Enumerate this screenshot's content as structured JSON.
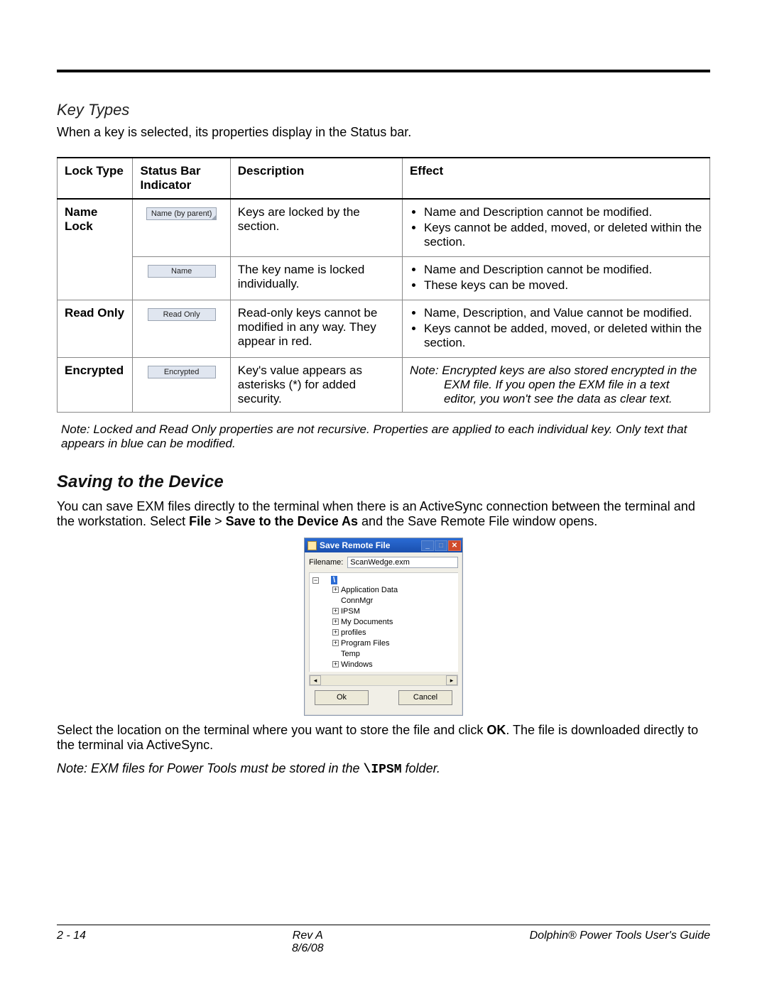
{
  "section": {
    "title": "Key Types",
    "intro": "When a key is selected, its properties display in the Status bar."
  },
  "table": {
    "headers": {
      "locktype": "Lock Type",
      "statusbar": "Status Bar Indicator",
      "description": "Description",
      "effect": "Effect"
    },
    "rows": {
      "namelock": {
        "label": "Name Lock",
        "ind1": "Name (by parent)",
        "desc1": "Keys are locked by the section.",
        "eff1a": "Name and Description cannot be modified.",
        "eff1b": "Keys cannot be added, moved, or deleted within the section.",
        "ind2": "Name",
        "desc2": "The key name is locked individually.",
        "eff2a": "Name and Description cannot be modified.",
        "eff2b": "These keys can be moved."
      },
      "readonly": {
        "label": "Read Only",
        "ind": "Read Only",
        "desc": "Read-only keys cannot be modified in any way. They appear in red.",
        "effa": "Name, Description, and Value cannot be modified.",
        "effb": "Keys cannot be added, moved, or deleted within the section."
      },
      "encrypted": {
        "label": "Encrypted",
        "ind": "Encrypted",
        "desc": "Key's value appears as asterisks (*) for added security.",
        "eff": "Note: Encrypted keys are also stored encrypted in the EXM file. If you open the EXM file in a text editor, you won't see the data as clear text."
      }
    }
  },
  "note1": "Note: Locked and Read Only properties are not recursive. Properties are applied to each individual key. Only text that appears in blue can be modified.",
  "saving": {
    "title": "Saving to the Device",
    "body_pre": "You can save EXM files directly to the terminal when there is an ActiveSync connection between the terminal and the workstation. Select ",
    "menu_file": "File",
    "menu_gt": " > ",
    "menu_save": "Save to the Device As",
    "body_post": " and the Save Remote File window opens.",
    "after": "Select the location on the terminal where you want to store the file and click ",
    "ok_bold": "OK",
    "after2": ". The file is downloaded directly to the terminal via ActiveSync.",
    "note2_pre": "Note: EXM files for Power Tools must be stored in the ",
    "note2_mono": "\\IPSM",
    "note2_post": " folder."
  },
  "dialog": {
    "title": "Save Remote File",
    "filename_label": "Filename:",
    "filename_value": "ScanWedge.exm",
    "root": "\\",
    "items": [
      {
        "exp": "+",
        "label": "Application Data"
      },
      {
        "exp": "",
        "label": "ConnMgr"
      },
      {
        "exp": "+",
        "label": "IPSM"
      },
      {
        "exp": "+",
        "label": "My Documents"
      },
      {
        "exp": "+",
        "label": "profiles"
      },
      {
        "exp": "+",
        "label": "Program Files"
      },
      {
        "exp": "",
        "label": "Temp"
      },
      {
        "exp": "+",
        "label": "Windows"
      }
    ],
    "ok": "Ok",
    "cancel": "Cancel"
  },
  "footer": {
    "left": "2 - 14",
    "center1": "Rev A",
    "center2": "8/6/08",
    "right": "Dolphin® Power Tools User's Guide"
  }
}
